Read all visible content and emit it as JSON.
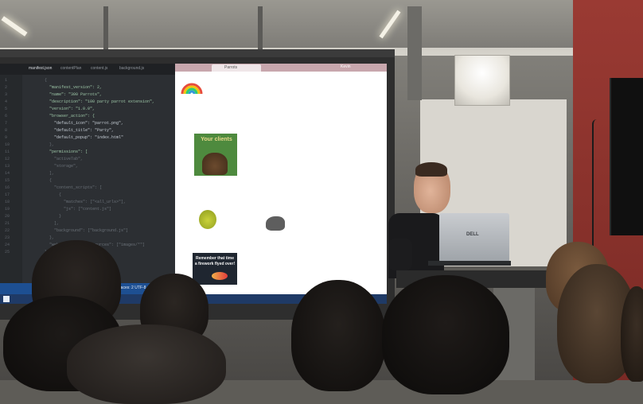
{
  "scene": {
    "type": "photo",
    "subject": "presentation"
  },
  "editor": {
    "tabs": [
      {
        "label": "manifest.json",
        "active": true
      },
      {
        "label": "contentPlan",
        "active": false
      },
      {
        "label": "content.js",
        "active": false
      },
      {
        "label": "background.js",
        "active": false
      }
    ],
    "code_lines": [
      {
        "text": "{",
        "cls": "dim"
      },
      {
        "text": "  \"manifest_version\": 2,",
        "cls": "key"
      },
      {
        "text": "  \"name\": \"300 Parrots\",",
        "cls": "key"
      },
      {
        "text": "  \"description\": \"100 party parrot extension\",",
        "cls": "key"
      },
      {
        "text": "  \"version\": \"1.0.0\",",
        "cls": "key"
      },
      {
        "text": "  \"browser_action\": {",
        "cls": "key"
      },
      {
        "text": "    \"default_icon\": \"parrot.png\",",
        "cls": ""
      },
      {
        "text": "    \"default_title\": \"Party\",",
        "cls": ""
      },
      {
        "text": "    \"default_popup\": \"index.html\"",
        "cls": ""
      },
      {
        "text": "  },",
        "cls": "dim"
      },
      {
        "text": "  \"permissions\": [",
        "cls": "key"
      },
      {
        "text": "    \"activeTab\",",
        "cls": "dim"
      },
      {
        "text": "    \"storage\",",
        "cls": "dim"
      },
      {
        "text": "  ],",
        "cls": "dim"
      },
      {
        "text": "  {",
        "cls": "dim"
      },
      {
        "text": "    \"content_scripts\": [",
        "cls": "dim"
      },
      {
        "text": "      {",
        "cls": "dim"
      },
      {
        "text": "        \"matches\": [\"<all_urls>\"],",
        "cls": "dim"
      },
      {
        "text": "        \"js\": [\"content.js\"]",
        "cls": "dim"
      },
      {
        "text": "      }",
        "cls": "dim"
      },
      {
        "text": "    ],",
        "cls": "dim"
      },
      {
        "text": "    \"background\": [\"background.js\"]",
        "cls": "dim"
      },
      {
        "text": "  },",
        "cls": "dim"
      },
      {
        "text": "  \"web_accessible_resources\": [\"images/*\"]",
        "cls": "dim"
      },
      {
        "text": "}",
        "cls": "dim"
      }
    ],
    "status_text": "Ln 1, Col 1   Spaces: 2   UTF-8   JSON"
  },
  "browser": {
    "tab_title": "Parrots",
    "meta": "Kevin"
  },
  "slides": {
    "card_1_text": "Your clients",
    "card_2_text": "Remember that time a firework flyed over!"
  },
  "laptop": {
    "brand": "DELL"
  },
  "colors": {
    "editor_bg": "#2c2f33",
    "statusbar": "#1d4f92",
    "browser_chrome": "#c8a7ad",
    "wall_red": "#9a3a33"
  }
}
